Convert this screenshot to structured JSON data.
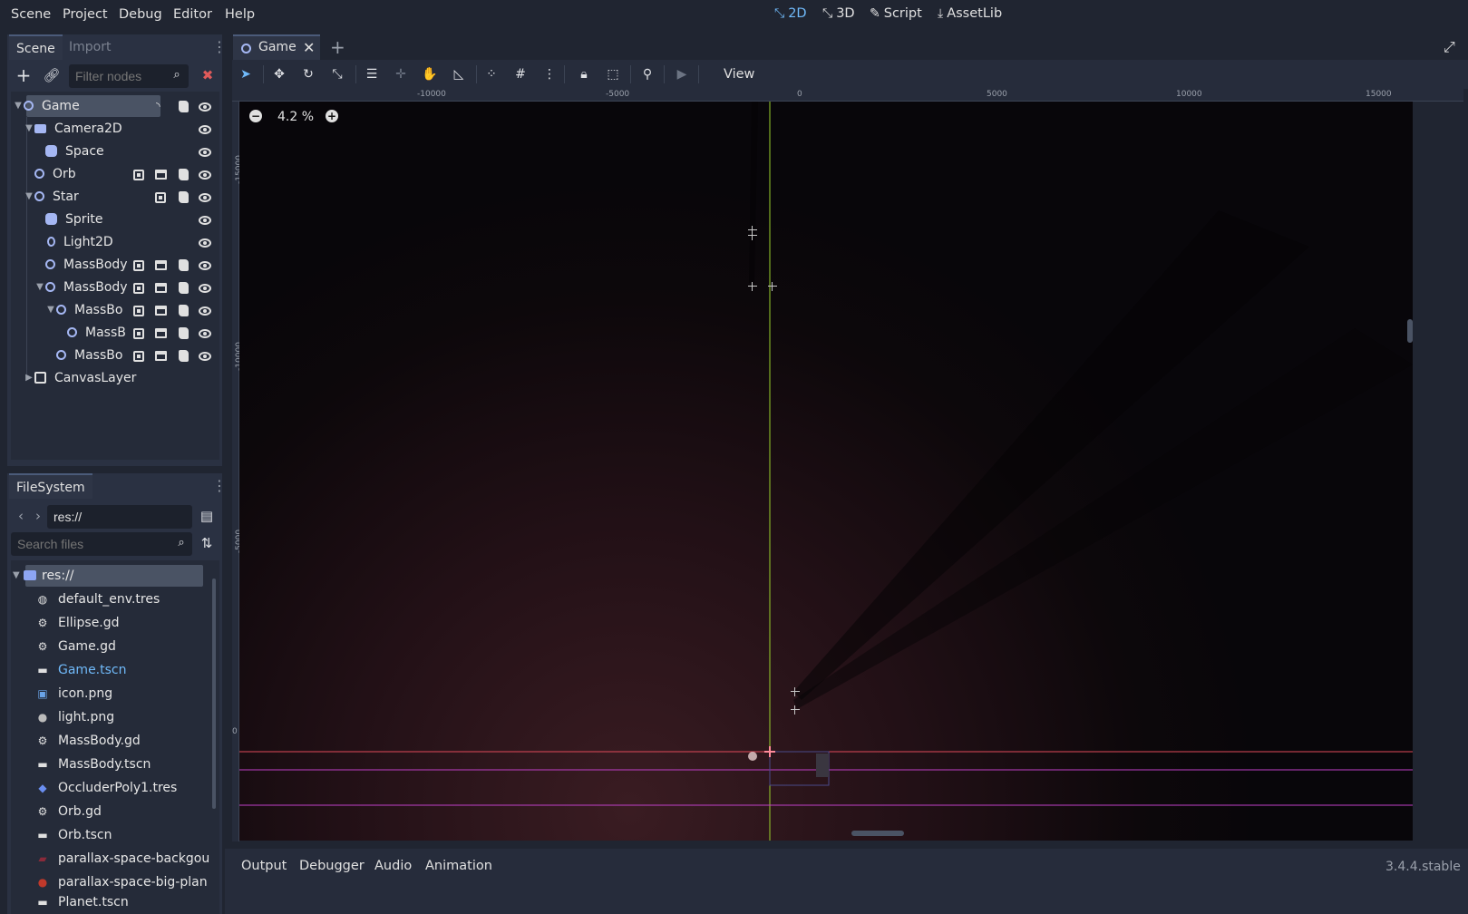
{
  "menu": [
    "Scene",
    "Project",
    "Debug",
    "Editor",
    "Help"
  ],
  "modes": [
    {
      "label": "2D",
      "icon": "2d-mode-icon",
      "active": true
    },
    {
      "label": "3D",
      "icon": "3d-mode-icon",
      "active": false
    },
    {
      "label": "Script",
      "icon": "script-icon",
      "active": false
    },
    {
      "label": "AssetLib",
      "icon": "assetlib-icon",
      "active": false
    }
  ],
  "scene_dock": {
    "tabs": [
      "Scene",
      "Import"
    ],
    "filter_placeholder": "Filter nodes",
    "tree": [
      {
        "label": "Game",
        "indent": 0,
        "expanded": true,
        "icon": "node2d-icon",
        "selected": true
      },
      {
        "label": "Camera2D",
        "indent": 1,
        "expanded": true,
        "icon": "camera2d-icon"
      },
      {
        "label": "Space",
        "indent": 2,
        "icon": "sprite-icon"
      },
      {
        "label": "Orb",
        "indent": 1,
        "icon": "node2d-icon"
      },
      {
        "label": "Star",
        "indent": 1,
        "expanded": true,
        "icon": "node2d-icon"
      },
      {
        "label": "Sprite",
        "indent": 2,
        "icon": "sprite-icon"
      },
      {
        "label": "Light2D",
        "indent": 2,
        "icon": "light2d-icon"
      },
      {
        "label": "MassBody",
        "indent": 2,
        "icon": "node2d-icon"
      },
      {
        "label": "MassBody",
        "indent": 2,
        "expanded": true,
        "icon": "node2d-icon"
      },
      {
        "label": "MassBo",
        "indent": 3,
        "expanded": true,
        "icon": "node2d-icon"
      },
      {
        "label": "MassB",
        "indent": 4,
        "icon": "node2d-icon"
      },
      {
        "label": "MassBo",
        "indent": 3,
        "icon": "node2d-icon"
      },
      {
        "label": "CanvasLayer",
        "indent": 1,
        "collapsed": true,
        "icon": "canvaslayer-icon"
      }
    ]
  },
  "filesystem": {
    "tab": "FileSystem",
    "path": "res://",
    "search_placeholder": "Search files",
    "items": [
      {
        "label": "res://",
        "icon": "folder-icon",
        "selected": true
      },
      {
        "label": "default_env.tres",
        "icon": "environment-icon"
      },
      {
        "label": "Ellipse.gd",
        "icon": "gear-icon"
      },
      {
        "label": "Game.gd",
        "icon": "gear-icon"
      },
      {
        "label": "Game.tscn",
        "icon": "scene-icon",
        "highlight": true
      },
      {
        "label": "icon.png",
        "icon": "image-icon"
      },
      {
        "label": "light.png",
        "icon": "light-image-icon"
      },
      {
        "label": "MassBody.gd",
        "icon": "gear-icon"
      },
      {
        "label": "MassBody.tscn",
        "icon": "scene-icon"
      },
      {
        "label": "OccluderPoly1.tres",
        "icon": "occluder-icon"
      },
      {
        "label": "Orb.gd",
        "icon": "gear-icon"
      },
      {
        "label": "Orb.tscn",
        "icon": "scene-icon"
      },
      {
        "label": "parallax-space-backgou",
        "icon": "image-icon"
      },
      {
        "label": "parallax-space-big-plan",
        "icon": "planet-image-icon"
      },
      {
        "label": "Planet.tscn",
        "icon": "scene-icon"
      }
    ]
  },
  "editor": {
    "scene_tab": "Game",
    "view_menu": "View",
    "zoom": "4.2 %",
    "ruler_x": [
      "-10000",
      "-5000",
      "0",
      "5000",
      "10000",
      "15000"
    ],
    "ruler_y": [
      "-15000",
      "-10000",
      "-5000",
      "0"
    ]
  },
  "bottom": {
    "tabs": [
      "Output",
      "Debugger",
      "Audio",
      "Animation"
    ],
    "version": "3.4.4.stable"
  }
}
